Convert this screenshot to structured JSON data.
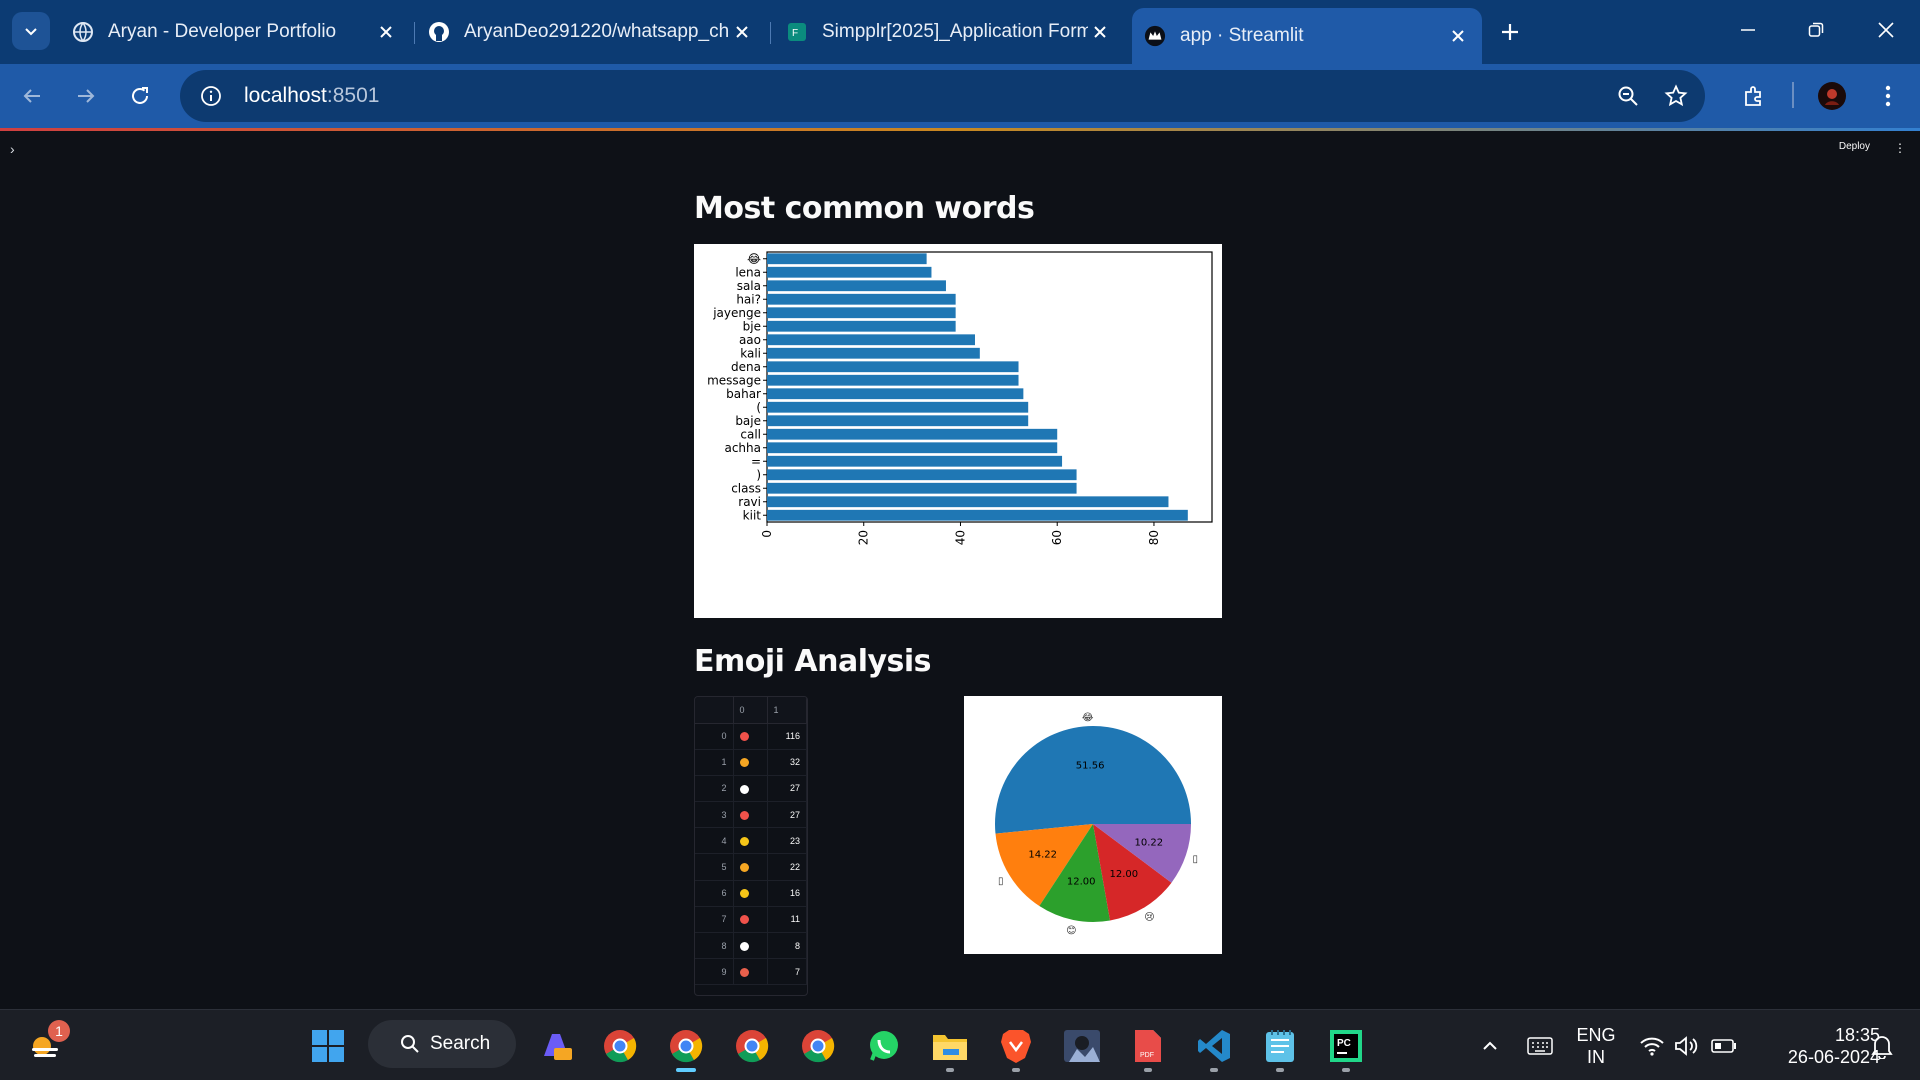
{
  "browser": {
    "tabs": [
      {
        "title": "Aryan - Developer Portfolio",
        "favicon": "globe-icon",
        "active": false
      },
      {
        "title": "AryanDeo291220/whatsapp_ch",
        "favicon": "github-icon",
        "active": false
      },
      {
        "title": "Simpplr[2025]_Application Form",
        "favicon": "forms-icon",
        "active": false
      },
      {
        "title": "app · Streamlit",
        "favicon": "streamlit-crown-icon",
        "active": true
      }
    ],
    "url_host": "localhost",
    "url_port": ":8501"
  },
  "streamlit": {
    "deploy_label": "Deploy",
    "sidebar_toggle": "›",
    "menu_glyph": "⋮"
  },
  "sections": {
    "common_words_title": "Most common words",
    "emoji_title": "Emoji Analysis"
  },
  "chart_data": [
    {
      "type": "bar",
      "orientation": "horizontal",
      "categories": [
        "kiit",
        "ravi",
        "class",
        ")",
        "=",
        "achha",
        "call",
        "baje",
        "(",
        "bahar",
        "message",
        "dena",
        "kali",
        "aao",
        "bje",
        "jayenge",
        "hai?",
        "sala",
        "lena",
        "😂"
      ],
      "values": [
        87,
        83,
        64,
        64,
        61,
        60,
        60,
        54,
        54,
        53,
        52,
        52,
        44,
        43,
        39,
        39,
        39,
        37,
        34,
        33
      ],
      "xlim": [
        0,
        92
      ],
      "xticks": [
        0,
        20,
        40,
        60,
        80
      ],
      "color": "#1f77b4"
    },
    {
      "type": "pie",
      "slices": [
        {
          "label": "😂",
          "value": 51.56,
          "text": "51.56",
          "color": "#1f77b4"
        },
        {
          "label": "▯",
          "value": 14.22,
          "text": "14.22",
          "color": "#ff7f0e"
        },
        {
          "label": "😊",
          "value": 12.0,
          "text": "12.00",
          "color": "#2ca02c"
        },
        {
          "label": "😢",
          "value": 12.0,
          "text": "12.00",
          "color": "#d62728"
        },
        {
          "label": "▯",
          "value": 10.22,
          "text": "10.22",
          "color": "#9467bd"
        }
      ]
    }
  ],
  "emoji_table": {
    "columns": [
      "",
      "0",
      "1"
    ],
    "rows": [
      {
        "index": "0",
        "emoji_color": "#f0524b",
        "count": "116"
      },
      {
        "index": "1",
        "emoji_color": "#f5a623",
        "count": "32"
      },
      {
        "index": "2",
        "emoji_color": "#ffffff",
        "count": "27"
      },
      {
        "index": "3",
        "emoji_color": "#f0524b",
        "count": "27"
      },
      {
        "index": "4",
        "emoji_color": "#f5c518",
        "count": "23"
      },
      {
        "index": "5",
        "emoji_color": "#f5a623",
        "count": "22"
      },
      {
        "index": "6",
        "emoji_color": "#f5c518",
        "count": "16"
      },
      {
        "index": "7",
        "emoji_color": "#f0524b",
        "count": "11"
      },
      {
        "index": "8",
        "emoji_color": "#ffffff",
        "count": "8"
      },
      {
        "index": "9",
        "emoji_color": "#e8604c",
        "count": "7"
      }
    ]
  },
  "taskbar": {
    "search_label": "Search",
    "weather_badge": "1",
    "lang_line1": "ENG",
    "lang_line2": "IN",
    "time": "18:35",
    "date": "26-06-2024"
  }
}
